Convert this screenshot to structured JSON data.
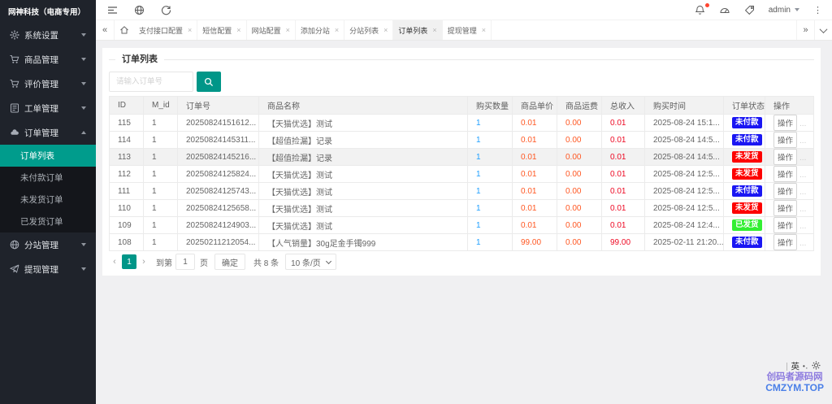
{
  "app": {
    "title": "网神科技（电商专用）"
  },
  "topbar": {
    "user": "admin"
  },
  "sidebar": {
    "items": [
      {
        "label": "系统设置",
        "icon": "gear-icon"
      },
      {
        "label": "商品管理",
        "icon": "cart-icon"
      },
      {
        "label": "评价管理",
        "icon": "star-icon"
      },
      {
        "label": "工单管理",
        "icon": "ticket-icon"
      },
      {
        "label": "订单管理",
        "icon": "orders-icon",
        "expanded": true,
        "children": [
          "订单列表",
          "未付款订单",
          "未发货订单",
          "已发货订单"
        ],
        "active_child": 0
      },
      {
        "label": "分站管理",
        "icon": "globe-icon"
      },
      {
        "label": "提现管理",
        "icon": "withdraw-icon"
      }
    ]
  },
  "tabs": {
    "items": [
      "支付接口配置",
      "短信配置",
      "网站配置",
      "添加分站",
      "分站列表",
      "订单列表",
      "提现管理"
    ],
    "active_index": 5
  },
  "panel": {
    "title": "订单列表",
    "search_placeholder": "请输入订单号"
  },
  "table": {
    "columns": [
      "ID",
      "M_id",
      "订单号",
      "商品名称",
      "购买数量",
      "商品单价",
      "商品运费",
      "总收入",
      "购买时间",
      "订单状态",
      "操作"
    ],
    "action_label": "操作",
    "rows": [
      {
        "id": "115",
        "mid": "1",
        "order_no": "20250824151612...",
        "product": "【天猫优选】测试",
        "qty": "1",
        "price": "0.01",
        "ship": "0.00",
        "total": "0.01",
        "time": "2025-08-24 15:1...",
        "status": "未付款",
        "status_color": "blue",
        "highlight": false
      },
      {
        "id": "114",
        "mid": "1",
        "order_no": "20250824145311...",
        "product": "【超值捡漏】记录",
        "qty": "1",
        "price": "0.01",
        "ship": "0.00",
        "total": "0.01",
        "time": "2025-08-24 14:5...",
        "status": "未付款",
        "status_color": "blue",
        "highlight": false
      },
      {
        "id": "113",
        "mid": "1",
        "order_no": "20250824145216...",
        "product": "【超值捡漏】记录",
        "qty": "1",
        "price": "0.01",
        "ship": "0.00",
        "total": "0.01",
        "time": "2025-08-24 14:5...",
        "status": "未发货",
        "status_color": "red",
        "highlight": true
      },
      {
        "id": "112",
        "mid": "1",
        "order_no": "20250824125824...",
        "product": "【天猫优选】测试",
        "qty": "1",
        "price": "0.01",
        "ship": "0.00",
        "total": "0.01",
        "time": "2025-08-24 12:5...",
        "status": "未发货",
        "status_color": "red",
        "highlight": false
      },
      {
        "id": "111",
        "mid": "1",
        "order_no": "20250824125743...",
        "product": "【天猫优选】测试",
        "qty": "1",
        "price": "0.01",
        "ship": "0.00",
        "total": "0.01",
        "time": "2025-08-24 12:5...",
        "status": "未付款",
        "status_color": "blue",
        "highlight": false
      },
      {
        "id": "110",
        "mid": "1",
        "order_no": "20250824125658...",
        "product": "【天猫优选】测试",
        "qty": "1",
        "price": "0.01",
        "ship": "0.00",
        "total": "0.01",
        "time": "2025-08-24 12:5...",
        "status": "未发货",
        "status_color": "red",
        "highlight": false
      },
      {
        "id": "109",
        "mid": "1",
        "order_no": "20250824124903...",
        "product": "【天猫优选】测试",
        "qty": "1",
        "price": "0.01",
        "ship": "0.00",
        "total": "0.01",
        "time": "2025-08-24 12:4...",
        "status": "已发货",
        "status_color": "green",
        "highlight": false
      },
      {
        "id": "108",
        "mid": "1",
        "order_no": "20250211212054...",
        "product": "【人气销量】30g足金手镯999",
        "qty": "1",
        "price": "99.00",
        "ship": "0.00",
        "total": "99.00",
        "time": "2025-02-11 21:20...",
        "status": "未付款",
        "status_color": "blue",
        "highlight": false
      }
    ]
  },
  "status_colors": {
    "blue": "#1a16f3",
    "red": "#fd0100",
    "green": "#32ef32"
  },
  "pagination": {
    "prev": "‹",
    "current": "1",
    "next": "›",
    "goto_label": "到第",
    "page_input": "1",
    "page_label": "页",
    "confirm_label": "确定",
    "total_label": "共 8 条",
    "per_page": "10 条/页"
  },
  "ime": {
    "lang": "英"
  },
  "watermark": {
    "line1": "创码者源码网",
    "line2": "CMZYM.TOP"
  }
}
